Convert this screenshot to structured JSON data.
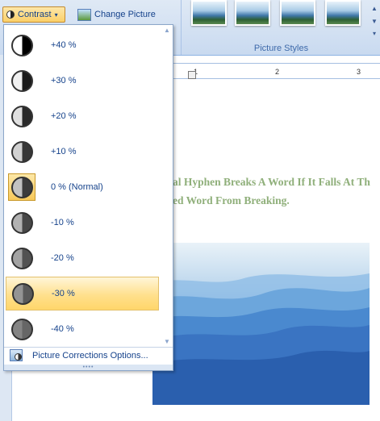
{
  "ribbon": {
    "contrast_label": "Contrast",
    "change_picture_label": "Change Picture",
    "picture_styles_label": "Picture Styles"
  },
  "ruler": {
    "ticks": [
      "1",
      "2",
      "3"
    ]
  },
  "document": {
    "line1": "al Hyphen Breaks A Word If It Falls At Th",
    "line2": "ed  Word From Breaking."
  },
  "contrast_menu": {
    "items": [
      {
        "label": "+40 %",
        "fill": "#000000"
      },
      {
        "label": "+30 %",
        "fill": "#1a1a1a"
      },
      {
        "label": "+20 %",
        "fill": "#2a2a2a"
      },
      {
        "label": "+10 %",
        "fill": "#363636"
      },
      {
        "label": "0 % (Normal)",
        "fill": "#3c3c3c"
      },
      {
        "label": "-10 %",
        "fill": "#474747"
      },
      {
        "label": "-20 %",
        "fill": "#525252"
      },
      {
        "label": "-30 %",
        "fill": "#5a5a5a"
      },
      {
        "label": "-40 %",
        "fill": "#666666"
      }
    ],
    "current_item": "0 % (Normal)",
    "highlighted_item": "-30 %",
    "footer_label": "Picture Corrections Options..."
  },
  "colors": {
    "doc_text": "#8faf7a",
    "menu_text": "#15428b",
    "highlight": "#ffd66a"
  }
}
